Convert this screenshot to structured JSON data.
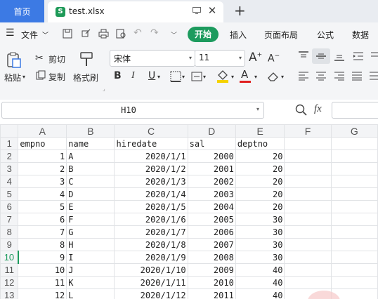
{
  "tabs": {
    "home": "首页",
    "file_name": "test.xlsx",
    "file_icon_letter": "S"
  },
  "menu": {
    "file": "文件",
    "items": [
      "开始",
      "插入",
      "页面布局",
      "公式",
      "数据"
    ]
  },
  "toolbar": {
    "paste": "粘贴",
    "cut": "剪切",
    "copy": "复制",
    "format_painter": "格式刷",
    "font_name": "宋体",
    "font_size": "11",
    "bold": "B",
    "italic": "I",
    "underline": "U",
    "font_color_glyph": "A",
    "accent_colors": {
      "start": "#1d9b5e",
      "home_tab": "#3c7ae4",
      "font_color": "#e02020",
      "fill_color": "#f5d200"
    }
  },
  "formula_bar": {
    "cell_ref": "H10",
    "fx": "fx"
  },
  "sheet": {
    "columns": [
      "A",
      "B",
      "C",
      "D",
      "E",
      "F",
      "G"
    ],
    "active_row": 10,
    "rows": [
      {
        "n": "1",
        "cells": [
          "empno",
          "name",
          "hiredate",
          "sal",
          "deptno"
        ]
      },
      {
        "n": "2",
        "cells": [
          "1",
          "A",
          "2020/1/1",
          "2000",
          "20"
        ]
      },
      {
        "n": "3",
        "cells": [
          "2",
          "B",
          "2020/1/2",
          "2001",
          "20"
        ]
      },
      {
        "n": "4",
        "cells": [
          "3",
          "C",
          "2020/1/3",
          "2002",
          "20"
        ]
      },
      {
        "n": "5",
        "cells": [
          "4",
          "D",
          "2020/1/4",
          "2003",
          "20"
        ]
      },
      {
        "n": "6",
        "cells": [
          "5",
          "E",
          "2020/1/5",
          "2004",
          "20"
        ]
      },
      {
        "n": "7",
        "cells": [
          "6",
          "F",
          "2020/1/6",
          "2005",
          "30"
        ]
      },
      {
        "n": "8",
        "cells": [
          "7",
          "G",
          "2020/1/7",
          "2006",
          "30"
        ]
      },
      {
        "n": "9",
        "cells": [
          "8",
          "H",
          "2020/1/8",
          "2007",
          "30"
        ]
      },
      {
        "n": "10",
        "cells": [
          "9",
          "I",
          "2020/1/9",
          "2008",
          "30"
        ]
      },
      {
        "n": "11",
        "cells": [
          "10",
          "J",
          "2020/1/10",
          "2009",
          "40"
        ]
      },
      {
        "n": "12",
        "cells": [
          "11",
          "K",
          "2020/1/11",
          "2010",
          "40"
        ]
      },
      {
        "n": "13",
        "cells": [
          "12",
          "L",
          "2020/1/12",
          "2011",
          "40"
        ]
      }
    ]
  }
}
